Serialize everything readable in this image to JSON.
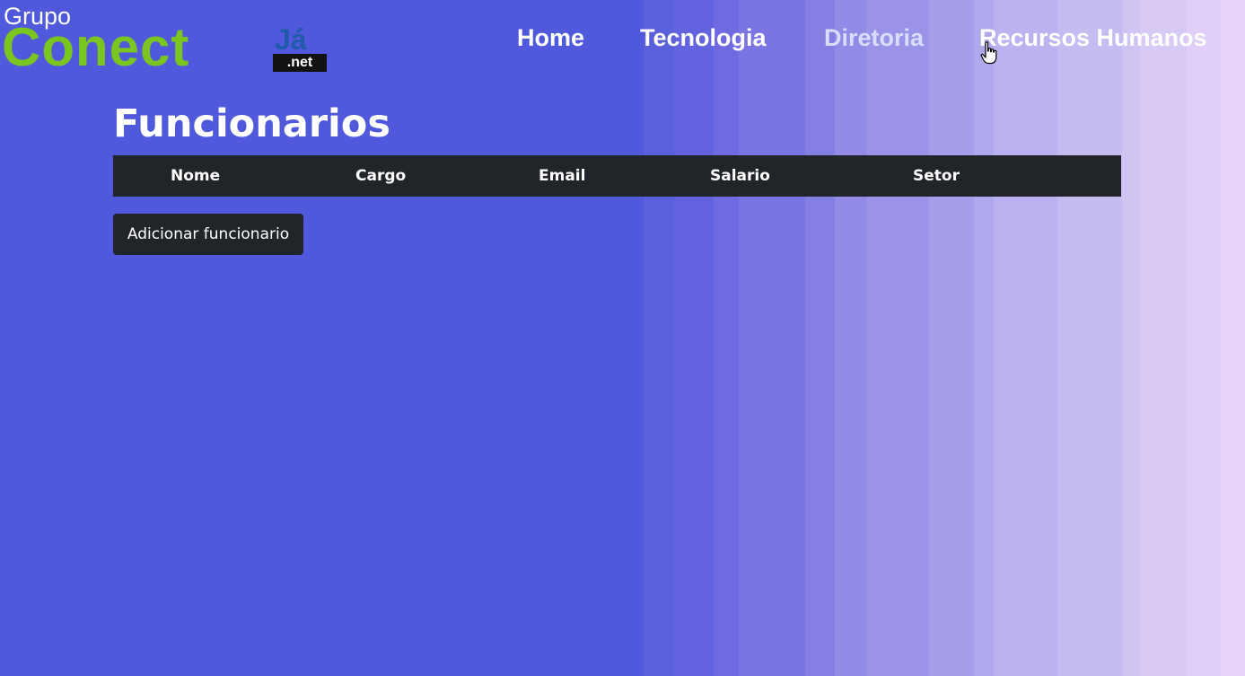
{
  "logo": {
    "line1": "Grupo",
    "line2": "Conect",
    "line3": "Já",
    "line4": ".net"
  },
  "nav": {
    "items": [
      {
        "label": "Home"
      },
      {
        "label": "Tecnologia"
      },
      {
        "label": "Diretoria"
      },
      {
        "label": "Recursos Humanos"
      }
    ]
  },
  "page": {
    "title": "Funcionarios",
    "table": {
      "columns": [
        "Nome",
        "Cargo",
        "Email",
        "Salario",
        "Setor"
      ],
      "rows": []
    },
    "add_button_label": "Adicionar funcionario"
  },
  "colors": {
    "background": "#5059db",
    "table_header_bg": "#212529",
    "logo_green": "#7ac520",
    "logo_blue": "#1e5aa8"
  },
  "cursor": {
    "icon": "hand-pointer-icon"
  }
}
